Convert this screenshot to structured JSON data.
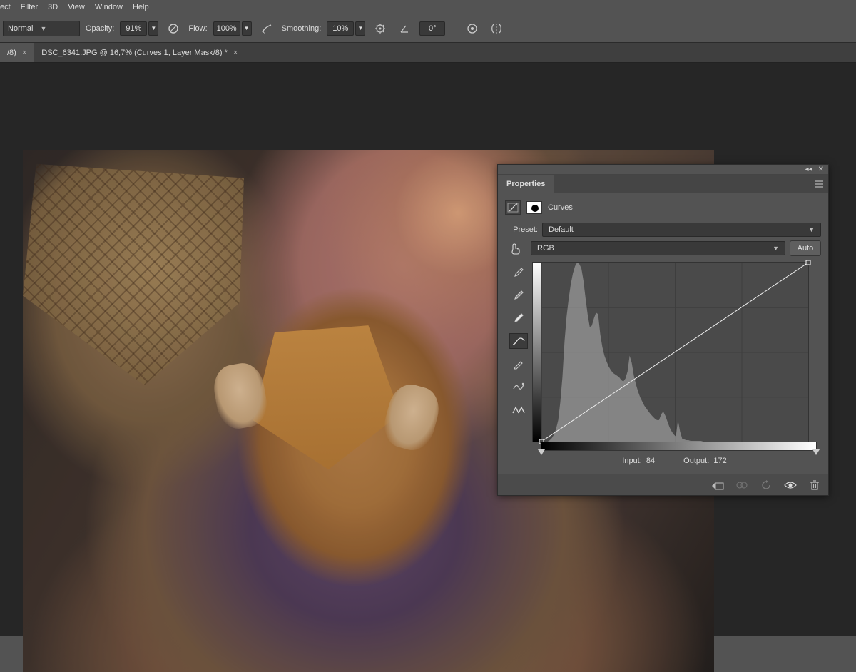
{
  "menu": {
    "items": [
      "ect",
      "Filter",
      "3D",
      "View",
      "Window",
      "Help"
    ]
  },
  "options": {
    "mode": "Normal",
    "opacity_label": "Opacity:",
    "opacity_value": "91%",
    "flow_label": "Flow:",
    "flow_value": "100%",
    "smoothing_label": "Smoothing:",
    "smoothing_value": "10%",
    "angle_value": "0°"
  },
  "tabs": {
    "left": "/8)",
    "active": "DSC_6341.JPG @ 16,7% (Curves 1, Layer Mask/8) *"
  },
  "panel": {
    "title": "Properties",
    "adj_label": "Curves",
    "preset_label": "Preset:",
    "preset_value": "Default",
    "channel_value": "RGB",
    "auto_label": "Auto",
    "input_label": "Input:",
    "input_value": "84",
    "output_label": "Output:",
    "output_value": "172"
  },
  "chart_data": {
    "type": "line",
    "title": "Curves",
    "xlabel": "Input",
    "ylabel": "Output",
    "xlim": [
      0,
      255
    ],
    "ylim": [
      0,
      255
    ],
    "series": [
      {
        "name": "curve",
        "x": [
          0,
          255
        ],
        "y": [
          0,
          255
        ]
      }
    ],
    "points": [
      {
        "x": 0,
        "y": 0
      },
      {
        "x": 255,
        "y": 255
      }
    ],
    "histogram": [
      0,
      0,
      0,
      0,
      2,
      5,
      10,
      18,
      30,
      55,
      90,
      140,
      175,
      200,
      220,
      235,
      245,
      250,
      248,
      242,
      225,
      200,
      178,
      160,
      162,
      172,
      180,
      178,
      150,
      132,
      120,
      112,
      105,
      100,
      96,
      94,
      92,
      90,
      86,
      84,
      88,
      98,
      120,
      110,
      92,
      80,
      70,
      62,
      56,
      50,
      46,
      42,
      38,
      35,
      32,
      30,
      30,
      38,
      42,
      36,
      28,
      20,
      14,
      10,
      7,
      30,
      14,
      4,
      3,
      2,
      2,
      1,
      1,
      1,
      1,
      1,
      1,
      0,
      0,
      0,
      0,
      0,
      0,
      0,
      0,
      0,
      0,
      0,
      0,
      0,
      0,
      0,
      0,
      0,
      0,
      0,
      0,
      0,
      0,
      0,
      0,
      0,
      0,
      0,
      0,
      0,
      0,
      0,
      0,
      0,
      0,
      0,
      0,
      0,
      0,
      0,
      0,
      0,
      0,
      0,
      0,
      0,
      0,
      0,
      0,
      0,
      0,
      0
    ],
    "readout": {
      "input": 84,
      "output": 172
    }
  }
}
